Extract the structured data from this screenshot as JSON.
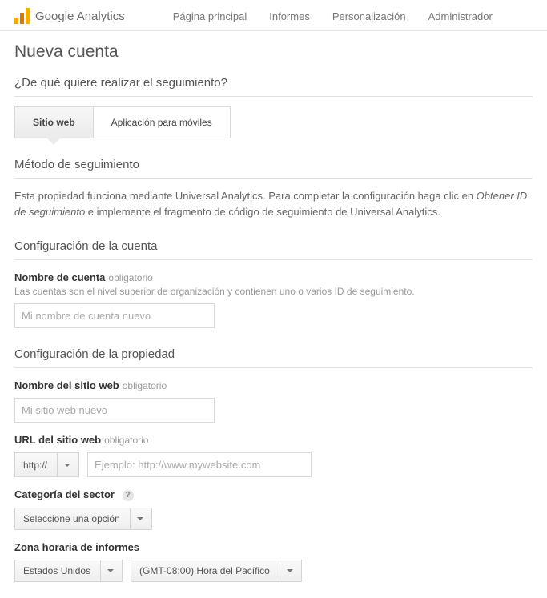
{
  "header": {
    "brand": "Google Analytics",
    "nav": {
      "home": "Página principal",
      "reports": "Informes",
      "customize": "Personalización",
      "admin": "Administrador"
    }
  },
  "page": {
    "title": "Nueva cuenta"
  },
  "track_what": {
    "heading": "¿De qué quiere realizar el seguimiento?",
    "tab_web": "Sitio web",
    "tab_mobile": "Aplicación para móviles"
  },
  "method": {
    "heading": "Método de seguimiento",
    "desc_1": "Esta propiedad funciona mediante Universal Analytics. Para completar la configuración haga clic en ",
    "desc_em": "Obtener ID de seguimiento",
    "desc_2": " e implemente el fragmento de código de seguimiento de Universal Analytics."
  },
  "account": {
    "heading": "Configuración de la cuenta",
    "name_label": "Nombre de cuenta",
    "required": "obligatorio",
    "name_hint": "Las cuentas son el nivel superior de organización y contienen uno o varios ID de seguimiento.",
    "name_placeholder": "Mi nombre de cuenta nuevo"
  },
  "property": {
    "heading": "Configuración de la propiedad",
    "site_name_label": "Nombre del sitio web",
    "site_name_placeholder": "Mi sitio web nuevo",
    "url_label": "URL del sitio web",
    "protocol": "http://",
    "url_placeholder": "Ejemplo: http://www.mywebsite.com",
    "category_label": "Categoría del sector",
    "category_value": "Seleccione una opción",
    "timezone_label": "Zona horaria de informes",
    "timezone_country": "Estados Unidos",
    "timezone_value": "(GMT-08:00) Hora del Pacífico"
  }
}
